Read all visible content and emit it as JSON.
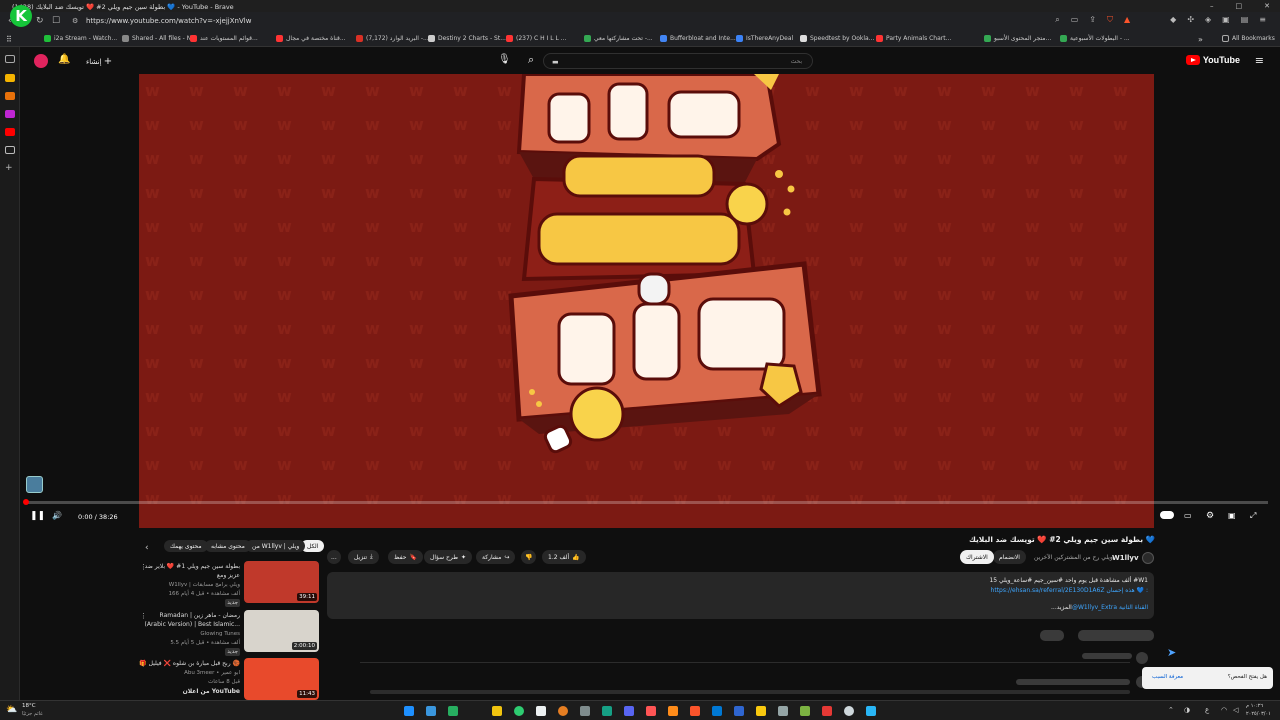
{
  "window": {
    "title": "(1438) بطولة سين جيم ويلي 2# ❤️ تويسك ضد البلايك 💙 - YouTube - Brave",
    "controls": [
      "–",
      "□",
      "✕"
    ]
  },
  "browser": {
    "url": "https://www.youtube.com/watch?v=-xjejjXnVlw",
    "all_bookmarks": "All Bookmarks",
    "bookmarks": [
      {
        "label": "i2a Stream - Watch...",
        "color": "#1fbf3a"
      },
      {
        "label": "Shared - All files - N...",
        "color": "#888888"
      },
      {
        "label": "قوائم المستويات عند...",
        "color": "#ff3333"
      },
      {
        "label": "قناة مختصة في مجال...",
        "color": "#ff3333"
      },
      {
        "label": "(7,172) البريد الوارد -...",
        "color": "#d93025"
      },
      {
        "label": "Destiny 2 Charts - St...",
        "color": "#cccccc"
      },
      {
        "label": "(237) C H I L L ...",
        "color": "#ff3333"
      },
      {
        "label": "تحت مشاركتها معي -...",
        "color": "#34a853"
      },
      {
        "label": "Bufferbloat and Inte...",
        "color": "#4285f4"
      },
      {
        "label": "IsThereAnyDeal",
        "color": "#3b82f6"
      },
      {
        "label": "Speedtest by Ookla...",
        "color": "#dddddd"
      },
      {
        "label": "Party Animals Chart...",
        "color": "#ff3333"
      },
      {
        "label": "متجر المحتوى الأسبو...",
        "color": "#34a853"
      },
      {
        "label": "البطولات الأسبوعية - ...",
        "color": "#34a853"
      }
    ]
  },
  "yt": {
    "create": "إنشاء",
    "search_placeholder": "بحث",
    "logo": "YouTube"
  },
  "video": {
    "time": "0:00 / 38:26",
    "progress": 0.0,
    "title": "بطولة سين جيم ويلي 2# ❤️ تويسك ضد البلايك 💙",
    "channel": "W1llyv",
    "subscribers": "ويلي رح من المشتركين الآخرين",
    "join": "الانضمام",
    "subscribe": "الاشتراك",
    "likes": "1.2 ألف",
    "share": "مشاركة",
    "ask": "طرح سؤال",
    "save": "حفظ",
    "download": "تنزيل",
    "more": "..."
  },
  "description": {
    "line1": "15 ألف مشاهدة قبل يوم واحد  #سين_جيم #ساعة_ويلي #W1",
    "line2": "https://ehsan.sa/referral/2E130D1A6Z  هذه إحسان 💙 :",
    "line3": "@W1llyv_Extra  القناة الثانية",
    "more": "...المزيد"
  },
  "chips": [
    {
      "label": "الكل",
      "active": true
    },
    {
      "label": "من W1llyv | ويلي",
      "active": false
    },
    {
      "label": "محتوى مشابه",
      "active": false
    },
    {
      "label": "محتوى يهمك",
      "active": false
    }
  ],
  "recommendations": [
    {
      "title": "بطولة سين جيم ويلي 1# ❤️ بلاير ضد",
      "title2": "عزيز ومع",
      "channel": "W1llyv | ويلي برامج مسابقات",
      "meta": "166 ألف مشاهدة • قبل 4 أيام",
      "badge": "جديد",
      "duration": "39:11",
      "thumb_color": "#c0392b"
    },
    {
      "title": "Ramadan | رمضان - ماهر زين",
      "title2": "(Arabic Version) | Best Islamic...",
      "channel": "Glowing Tunes",
      "meta": "5.5 ألف مشاهدة • قبل 5 أيام",
      "badge": "جديد",
      "duration": "2:00:10",
      "thumb_color": "#d8d4cc"
    },
    {
      "title": "🎁 ربح قبل مبارة بن شلوه ❌ فيليل 🏀",
      "title2": "",
      "channel": "Abu 3meer • ابو عمير",
      "meta": "قبل 8 ساعات",
      "badge": "",
      "duration": "11:43",
      "thumb_color": "#e84a2c"
    }
  ],
  "reco_footer": "من اعلان YouTube",
  "toast": {
    "question": "هل يفتح الفحص؟",
    "action": "معرفة السبب"
  },
  "taskbar": {
    "weather": "18°C",
    "weather_desc": "غائم جزئيًا",
    "clock_time": "١٠:٢٦ م",
    "clock_date": "٢٠٢٥/٠٣/٠١",
    "lang": "ع"
  }
}
